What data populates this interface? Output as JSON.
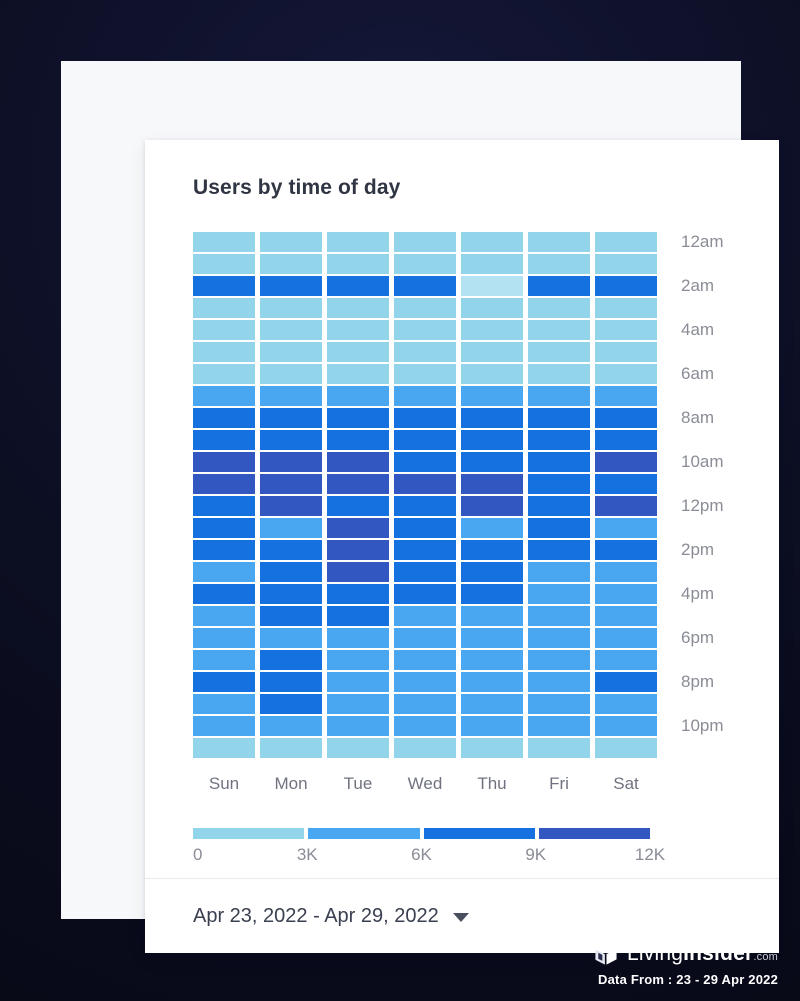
{
  "chart_data": {
    "type": "heatmap",
    "title": "Users by time of day",
    "xlabel": "",
    "ylabel": "",
    "categories": [
      "Sun",
      "Mon",
      "Tue",
      "Wed",
      "Thu",
      "Fri",
      "Sat"
    ],
    "rows": [
      "12am",
      "1am",
      "2am",
      "3am",
      "4am",
      "5am",
      "6am",
      "7am",
      "8am",
      "9am",
      "10am",
      "11am",
      "12pm",
      "1pm",
      "2pm",
      "3pm",
      "4pm",
      "5pm",
      "6pm",
      "7pm",
      "8pm",
      "9pm",
      "10pm",
      "11pm"
    ],
    "row_tick_labels": [
      "12am",
      "2am",
      "4am",
      "6am",
      "8am",
      "10am",
      "12pm",
      "2pm",
      "4pm",
      "6pm",
      "8pm",
      "10pm"
    ],
    "legend_position": "bottom",
    "grid": false,
    "value_range": [
      0,
      12000
    ],
    "legend": {
      "ticks": [
        "0",
        "3K",
        "6K",
        "9K",
        "12K"
      ],
      "bands": [
        {
          "label": "0 - 3K",
          "color": "#92d5ea",
          "min": 0,
          "max": 3000
        },
        {
          "label": "3K - 6K",
          "color": "#49a7f2",
          "min": 3000,
          "max": 6000
        },
        {
          "label": "6K - 9K",
          "color": "#1570e0",
          "min": 6000,
          "max": 9000
        },
        {
          "label": "9K - 12K",
          "color": "#3257c0",
          "min": 9000,
          "max": 12000
        }
      ]
    },
    "palette": {
      "t0_pale": "#b3e2f2",
      "t0": "#92d5ea",
      "t1": "#49a7f2",
      "t2": "#1570e0",
      "t3": "#3257c0"
    },
    "cell_tiers": [
      [
        0,
        0,
        0,
        0,
        0,
        0,
        0
      ],
      [
        0,
        0,
        0,
        0,
        0,
        0,
        0
      ],
      [
        2,
        2,
        2,
        2,
        -1,
        2,
        2
      ],
      [
        0,
        0,
        0,
        0,
        0,
        0,
        0
      ],
      [
        0,
        0,
        0,
        0,
        0,
        0,
        0
      ],
      [
        0,
        0,
        0,
        0,
        0,
        0,
        0
      ],
      [
        0,
        0,
        0,
        0,
        0,
        0,
        0
      ],
      [
        1,
        1,
        1,
        1,
        1,
        1,
        1
      ],
      [
        2,
        2,
        2,
        2,
        2,
        2,
        2
      ],
      [
        2,
        2,
        2,
        2,
        2,
        2,
        2
      ],
      [
        3,
        3,
        3,
        2,
        2,
        2,
        3
      ],
      [
        3,
        3,
        3,
        3,
        3,
        2,
        2
      ],
      [
        2,
        3,
        2,
        2,
        3,
        2,
        3
      ],
      [
        2,
        1,
        3,
        2,
        1,
        2,
        1
      ],
      [
        2,
        2,
        3,
        2,
        2,
        2,
        2
      ],
      [
        1,
        2,
        3,
        2,
        2,
        1,
        1
      ],
      [
        2,
        2,
        2,
        2,
        2,
        1,
        1
      ],
      [
        1,
        2,
        2,
        1,
        1,
        1,
        1
      ],
      [
        1,
        1,
        1,
        1,
        1,
        1,
        1
      ],
      [
        1,
        2,
        1,
        1,
        1,
        1,
        1
      ],
      [
        2,
        2,
        1,
        1,
        1,
        1,
        2
      ],
      [
        1,
        2,
        1,
        1,
        1,
        1,
        1
      ],
      [
        1,
        1,
        1,
        1,
        1,
        1,
        1
      ],
      [
        0,
        0,
        0,
        0,
        0,
        0,
        0
      ]
    ],
    "cell_values": [
      [
        1500,
        1500,
        1500,
        1500,
        1500,
        1500,
        1500
      ],
      [
        1600,
        1600,
        1600,
        1600,
        1600,
        1600,
        1600
      ],
      [
        7200,
        7300,
        7100,
        7000,
        900,
        7100,
        7200
      ],
      [
        1700,
        1700,
        1700,
        1700,
        1700,
        1700,
        1700
      ],
      [
        1600,
        1600,
        1600,
        1600,
        1600,
        1600,
        1600
      ],
      [
        1500,
        1500,
        1500,
        1500,
        1500,
        1500,
        1500
      ],
      [
        1700,
        1700,
        1700,
        1700,
        1700,
        1700,
        1700
      ],
      [
        4800,
        4900,
        4800,
        4900,
        4800,
        4900,
        4800
      ],
      [
        7600,
        7700,
        7600,
        7700,
        7600,
        7700,
        7600
      ],
      [
        7800,
        7900,
        7800,
        7900,
        7800,
        7900,
        7800
      ],
      [
        10200,
        10300,
        10100,
        8400,
        8300,
        8400,
        10100
      ],
      [
        10500,
        10600,
        10400,
        10300,
        10200,
        8600,
        8500
      ],
      [
        8400,
        10100,
        8300,
        8400,
        10000,
        8300,
        10200
      ],
      [
        8200,
        5600,
        10300,
        8100,
        5500,
        8000,
        5400
      ],
      [
        8300,
        8200,
        10400,
        8200,
        8300,
        8100,
        8200
      ],
      [
        5500,
        8100,
        10200,
        8000,
        8200,
        5300,
        5200
      ],
      [
        8100,
        8000,
        8100,
        8000,
        8100,
        5400,
        5300
      ],
      [
        5400,
        7900,
        7800,
        5200,
        5100,
        5300,
        5200
      ],
      [
        5300,
        5200,
        5100,
        5200,
        5100,
        5200,
        5100
      ],
      [
        5200,
        8000,
        5000,
        5100,
        5000,
        5100,
        5200
      ],
      [
        8000,
        8100,
        5100,
        5200,
        5100,
        5200,
        8000
      ],
      [
        5100,
        7900,
        5000,
        5100,
        5000,
        5100,
        5000
      ],
      [
        5000,
        5100,
        5000,
        5000,
        5000,
        5100,
        5000
      ],
      [
        1400,
        1400,
        1400,
        1400,
        1400,
        1400,
        1400
      ]
    ]
  },
  "footer": {
    "date_range": "Apr 23, 2022 - Apr 29, 2022",
    "caret_icon": "chevron-down-icon"
  },
  "branding": {
    "logo_icon": "living-insider-house-logo-icon",
    "name_part1": "Living",
    "name_part2": "Insider",
    "tld": ".com",
    "data_from": "Data From : 23 - 29 Apr 2022"
  }
}
